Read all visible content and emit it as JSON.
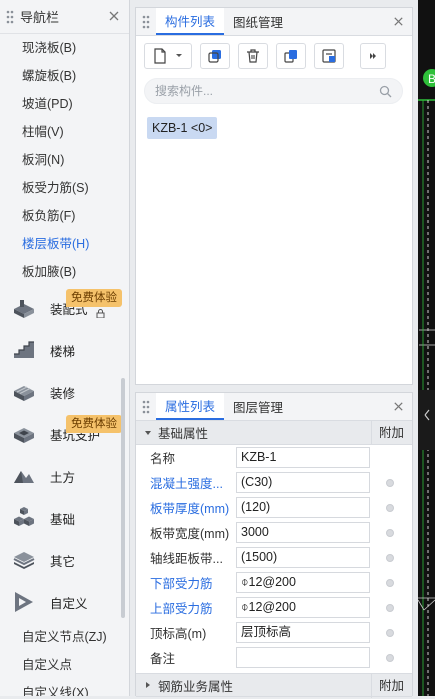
{
  "nav": {
    "title": "导航栏",
    "items": [
      {
        "label": "现浇板(B)",
        "active": false
      },
      {
        "label": "螺旋板(B)",
        "active": false
      },
      {
        "label": "坡道(PD)",
        "active": false
      },
      {
        "label": "柱帽(V)",
        "active": false
      },
      {
        "label": "板洞(N)",
        "active": false
      },
      {
        "label": "板受力筋(S)",
        "active": false
      },
      {
        "label": "板负筋(F)",
        "active": false
      },
      {
        "label": "楼层板带(H)",
        "active": true
      },
      {
        "label": "板加腋(B)",
        "active": false
      }
    ],
    "categories": [
      {
        "label": "装配式",
        "icon": "prefab-icon",
        "badge": "免费体验"
      },
      {
        "label": "楼梯",
        "icon": "stairs-icon",
        "badge": ""
      },
      {
        "label": "装修",
        "icon": "decoration-icon",
        "badge": ""
      },
      {
        "label": "基坑支护",
        "icon": "pit-support-icon",
        "badge": "免费体验"
      },
      {
        "label": "土方",
        "icon": "earthwork-icon",
        "badge": ""
      },
      {
        "label": "基础",
        "icon": "foundation-icon",
        "badge": ""
      },
      {
        "label": "其它",
        "icon": "other-icon",
        "badge": ""
      },
      {
        "label": "自定义",
        "icon": "custom-icon",
        "badge": ""
      }
    ],
    "bottom_items": [
      "自定义节点(ZJ)",
      "自定义点",
      "自定义线(X)"
    ]
  },
  "component_panel": {
    "tabs": [
      "构件列表",
      "图纸管理"
    ],
    "active_tab": 0,
    "search_placeholder": "搜索构件...",
    "components": [
      "KZB-1 <0>"
    ]
  },
  "properties_panel": {
    "tabs": [
      "属性列表",
      "图层管理"
    ],
    "active_tab": 0,
    "section_title": "基础属性",
    "extra_column": "附加",
    "rows": [
      {
        "name": "名称",
        "value": "KZB-1",
        "blue": false,
        "has_check": false
      },
      {
        "name": "混凝土强度...",
        "value": "(C30)",
        "blue": true,
        "has_check": true
      },
      {
        "name": "板带厚度(mm)",
        "value": "(120)",
        "blue": true,
        "has_check": true
      },
      {
        "name": "板带宽度(mm)",
        "value": "3000",
        "blue": false,
        "has_check": true
      },
      {
        "name": "轴线距板带...",
        "value": "(1500)",
        "blue": false,
        "has_check": true
      },
      {
        "name": "下部受力筋",
        "value": "⌽12@200",
        "blue": true,
        "has_check": true
      },
      {
        "name": "上部受力筋",
        "value": "⌽12@200",
        "blue": true,
        "has_check": true
      },
      {
        "name": "顶标高(m)",
        "value": "层顶标高",
        "blue": false,
        "has_check": true
      },
      {
        "name": "备注",
        "value": "",
        "blue": false,
        "has_check": true
      }
    ],
    "section2_title": "钢筋业务属性",
    "section2_extra": "附加"
  },
  "colors": {
    "accent": "#2a6de0",
    "badge": "#f5c26b",
    "chip": "#c9d9f2"
  }
}
